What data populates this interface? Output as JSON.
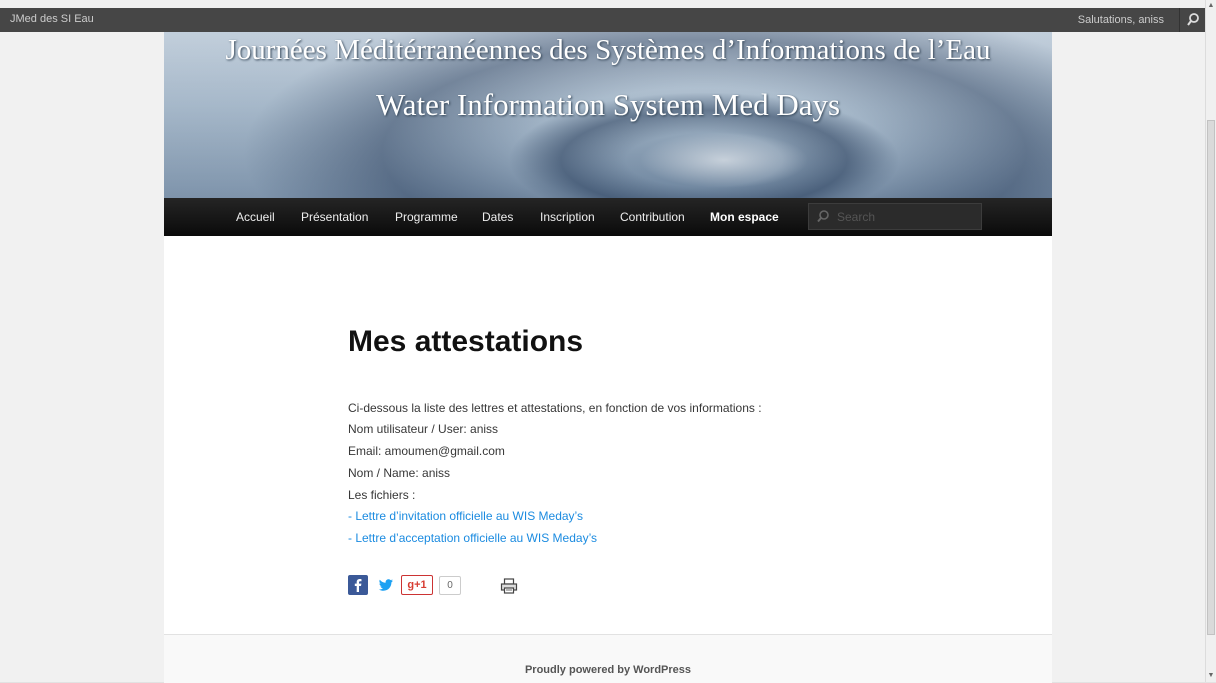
{
  "admin_bar": {
    "site_name": "JMed des SI Eau",
    "greeting": "Salutations, aniss",
    "search_icon": "search-icon"
  },
  "header": {
    "title_fr": "Journées Méditérranéennes des Systèmes d’Informations de l’Eau",
    "title_en": "Water Information System Med Days"
  },
  "nav": {
    "items": [
      {
        "label": "Accueil"
      },
      {
        "label": "Présentation"
      },
      {
        "label": "Programme"
      },
      {
        "label": "Dates"
      },
      {
        "label": "Inscription"
      },
      {
        "label": "Contribution"
      },
      {
        "label": "Mon espace",
        "active": true
      }
    ],
    "search_placeholder": "Search"
  },
  "content": {
    "title": "Mes attestations",
    "intro": "Ci-dessous la liste des lettres et attestations, en fonction de vos informations :",
    "user": "Nom utilisateur / User: aniss",
    "email": "Email: amoumen@gmail.com",
    "name": "Nom / Name: aniss",
    "files_label": "Les fichiers :",
    "files": [
      "- Lettre d’invitation officielle au WIS Meday’s",
      "- Lettre d’acceptation officielle au WIS Meday’s"
    ]
  },
  "share": {
    "gplus_label": "g+1",
    "gplus_count": "0",
    "icons": [
      "facebook-icon",
      "twitter-icon",
      "google-plus-icon",
      "print-icon"
    ]
  },
  "footer": {
    "text": "Proudly powered by WordPress"
  },
  "colors": {
    "link": "#1b8be0",
    "nav_bg": "#111111",
    "admin_bar": "#464646"
  }
}
